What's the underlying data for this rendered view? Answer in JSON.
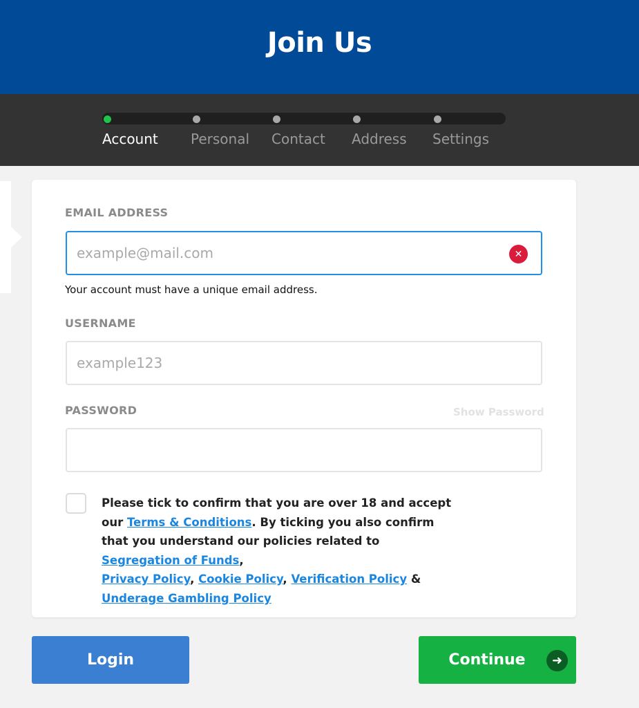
{
  "header": {
    "title": "Join Us"
  },
  "steps": [
    {
      "label": "Account",
      "active": true
    },
    {
      "label": "Personal",
      "active": false
    },
    {
      "label": "Contact",
      "active": false
    },
    {
      "label": "Address",
      "active": false
    },
    {
      "label": "Settings",
      "active": false
    }
  ],
  "form": {
    "email": {
      "label": "EMAIL ADDRESS",
      "placeholder": "example@mail.com",
      "value": "",
      "error": "Your account must have a unique email address."
    },
    "username": {
      "label": "USERNAME",
      "placeholder": "example123",
      "value": ""
    },
    "password": {
      "label": "PASSWORD",
      "value": "",
      "show_label": "Show Password"
    },
    "terms": {
      "text_1": "Please tick to confirm that you are over 18 and accept our ",
      "link_terms": "Terms & Conditions",
      "text_2": ". By ticking you also confirm that you understand our policies related to ",
      "link_segregation": "Segregation of Funds",
      "text_3": ",",
      "link_privacy": "Privacy Policy",
      "text_4": ", ",
      "link_cookie": "Cookie Policy",
      "text_5": ", ",
      "link_verification": "Verification Policy",
      "text_6": " & ",
      "link_underage": "Underage Gambling Policy",
      "checked": false
    }
  },
  "buttons": {
    "login": "Login",
    "continue": "Continue"
  },
  "icons": {
    "clear": "close-circle-icon",
    "arrow": "arrow-right-icon"
  },
  "colors": {
    "header": "#004a97",
    "accent": "#1f8fe8",
    "success": "#15b143",
    "error": "#d91c3b"
  }
}
